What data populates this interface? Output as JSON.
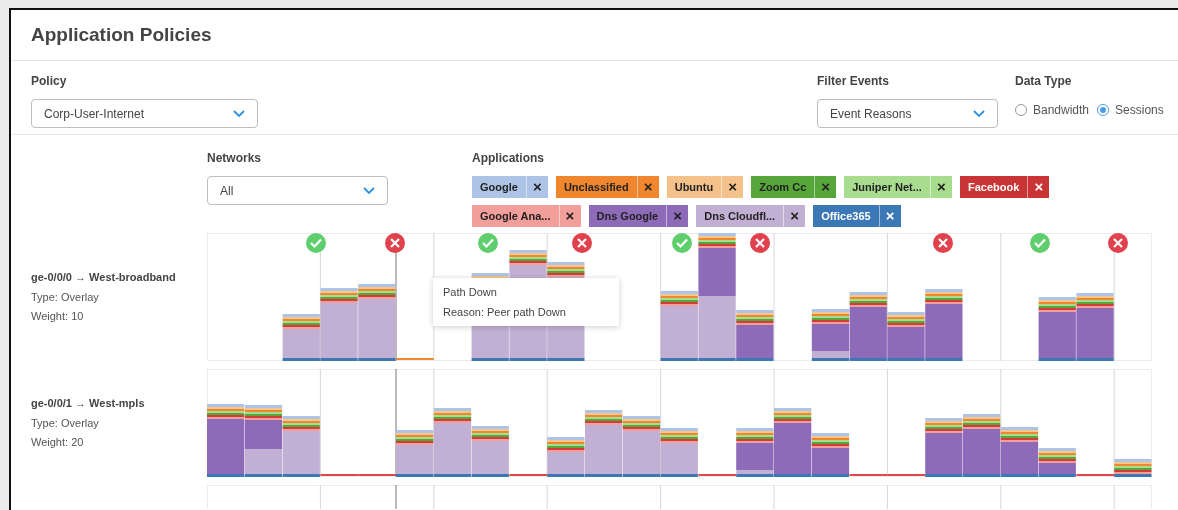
{
  "title": "Application Policies",
  "policy": {
    "label": "Policy",
    "value": "Corp-User-Internet"
  },
  "filter_events": {
    "label": "Filter Events",
    "value": "Event Reasons"
  },
  "data_type": {
    "label": "Data Type",
    "options": [
      {
        "label": "Bandwidth",
        "selected": false
      },
      {
        "label": "Sessions",
        "selected": true
      }
    ]
  },
  "networks": {
    "label": "Networks",
    "value": "All"
  },
  "applications": {
    "label": "Applications",
    "tags": [
      {
        "label": "Google",
        "color": "#aec4e6",
        "remove": "×"
      },
      {
        "label": "Unclassified",
        "color": "#f0872f",
        "remove": "×"
      },
      {
        "label": "Ubuntu",
        "color": "#f5c18a",
        "remove": "×"
      },
      {
        "label": "Zoom Cc",
        "color": "#57a63a",
        "remove": "×"
      },
      {
        "label": "Juniper Net...",
        "color": "#a8dc8f",
        "remove": "×"
      },
      {
        "label": "Facebook",
        "color": "#c93434",
        "remove": "×"
      },
      {
        "label": "Google Ana...",
        "color": "#f29f9b",
        "remove": "×"
      },
      {
        "label": "Dns Google",
        "color": "#8e6bb8",
        "remove": "×"
      },
      {
        "label": "Dns Cloudfl...",
        "color": "#c2b0d4",
        "remove": "×"
      },
      {
        "label": "Office365",
        "color": "#3b78b5",
        "remove": "×"
      }
    ]
  },
  "rows": [
    {
      "interface": "ge-0/0/0",
      "network": "West-broadband",
      "arrow": "→",
      "type": "Type: Overlay",
      "weight": "Weight: 10"
    },
    {
      "interface": "ge-0/0/1",
      "network": "West-mpls",
      "arrow": "→",
      "type": "Type: Overlay",
      "weight": "Weight: 20"
    }
  ],
  "tooltip": {
    "title": "Path Down",
    "reason": "Reason: Peer path Down"
  }
}
